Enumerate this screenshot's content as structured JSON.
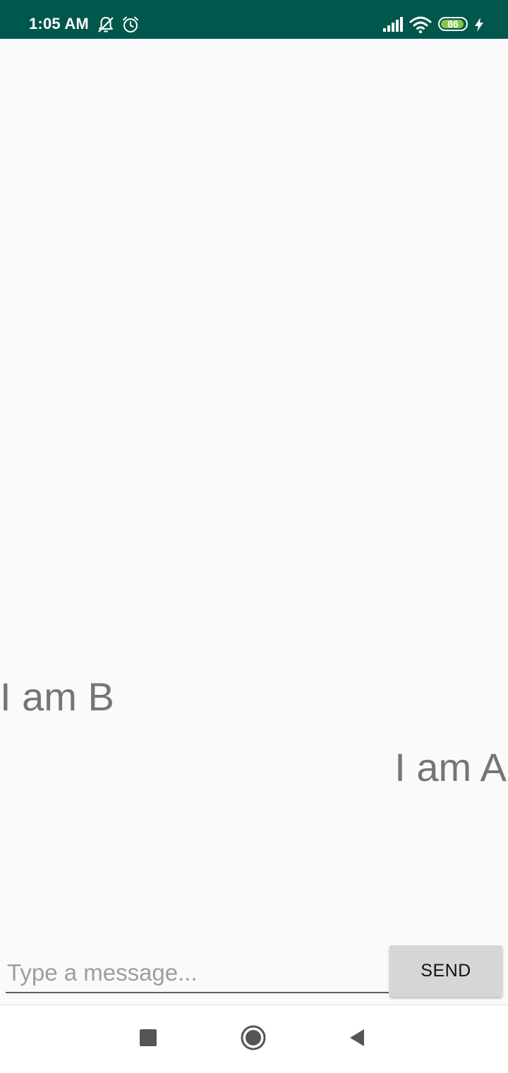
{
  "status_bar": {
    "time": "1:05 AM",
    "battery_level": "86",
    "background_color": "#00574b",
    "icons": [
      "bell-off-icon",
      "alarm-icon",
      "signal-icon",
      "wifi-icon",
      "battery-icon",
      "charging-icon"
    ]
  },
  "chat": {
    "messages": [
      {
        "text": "I am B",
        "side": "left"
      },
      {
        "text": "I am A",
        "side": "right"
      }
    ]
  },
  "composer": {
    "placeholder": "Type a message...",
    "value": "",
    "send_label": "SEND"
  },
  "nav_bar": {
    "icons": [
      "recents-icon",
      "home-icon",
      "back-icon"
    ]
  }
}
